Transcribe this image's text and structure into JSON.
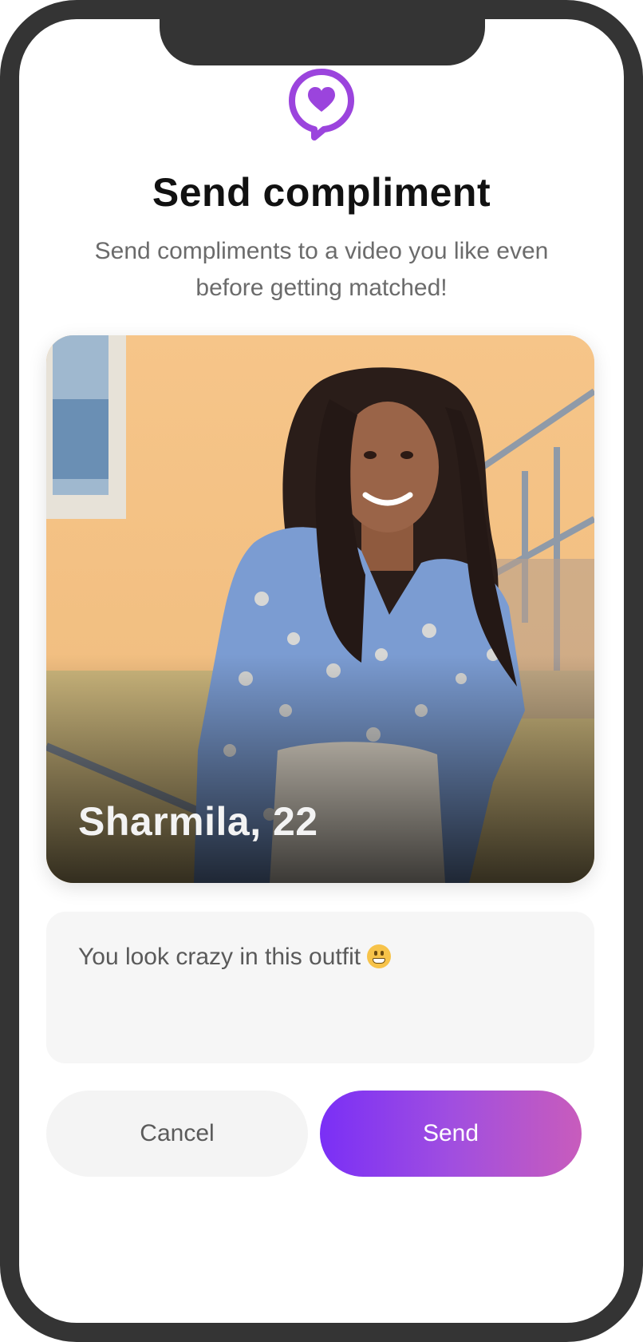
{
  "header": {
    "icon": "heart-speech-bubble-icon",
    "title": "Send compliment",
    "subtitle": "Send compliments to a video you like even before getting matched!"
  },
  "profile_card": {
    "name_age": "Sharmila, 22",
    "image": "woman-portrait-photo"
  },
  "message": {
    "text": "You look crazy in this outfit",
    "emoji": "grinning-face-emoji"
  },
  "actions": {
    "cancel_label": "Cancel",
    "send_label": "Send"
  },
  "colors": {
    "accent": "#9b44dd",
    "send_gradient_start": "#7a2ff6",
    "send_gradient_end": "#c85cbc",
    "frame": "#343434"
  }
}
